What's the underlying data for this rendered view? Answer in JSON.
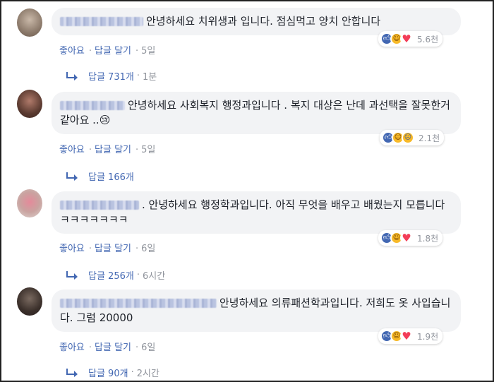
{
  "comments": [
    {
      "text": "안녕하세요 치위생과 입니다. 점심먹고 양치 안합니다",
      "reaction_count": "5.6천",
      "reactions": [
        "like-icon",
        "haha-icon",
        "love-icon"
      ],
      "like_label": "좋아요",
      "reply_label": "답글 달기",
      "time": "5일",
      "replies_label": "답글 731개",
      "replies_time": "1분"
    },
    {
      "text": "안녕하세요 사회복지 행정과입니다 . 복지 대상은 난데 과선택을 잘못한거같아요 ..😢",
      "reaction_count": "2.1천",
      "reactions": [
        "like-icon",
        "haha-icon",
        "sad-icon"
      ],
      "like_label": "좋아요",
      "reply_label": "답글 달기",
      "time": "5일",
      "replies_label": "답글 166개",
      "replies_time": ""
    },
    {
      "text": ". 안녕하세요 행정학과입니다. 아직 무엇을 배우고 배웠는지 모릅니다 ㅋㅋㅋㅋㅋㅋㅋ",
      "reaction_count": "1.8천",
      "reactions": [
        "like-icon",
        "haha-icon",
        "love-icon"
      ],
      "like_label": "좋아요",
      "reply_label": "답글 달기",
      "time": "6일",
      "replies_label": "답글 256개",
      "replies_time": "6시간"
    },
    {
      "text": "안녕하세요 의류패션학과입니다. 저희도 옷 사입습니다. 그럼 20000",
      "reaction_count": "1.9천",
      "reactions": [
        "like-icon",
        "haha-icon",
        "love-icon"
      ],
      "like_label": "좋아요",
      "reply_label": "답글 달기",
      "time": "6일",
      "replies_label": "답글 90개",
      "replies_time": "2시간"
    }
  ],
  "colors": {
    "link": "#4267b2",
    "bubble": "#f2f3f5",
    "meta": "#90949c"
  }
}
